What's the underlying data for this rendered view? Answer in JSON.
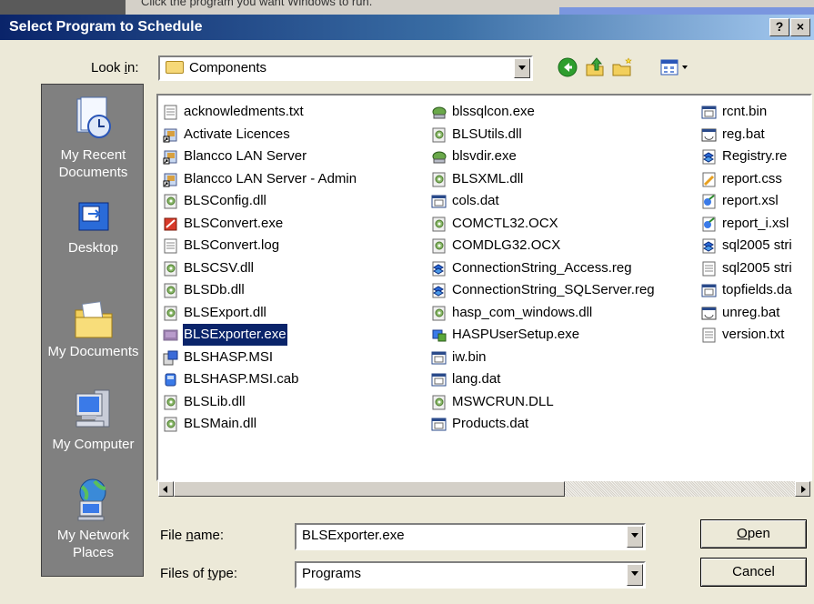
{
  "background_window": {
    "hint_text": "Click the program you want Windows to run."
  },
  "titlebar": {
    "title": "Select Program to Schedule",
    "help_label": "?",
    "close_label": "×"
  },
  "lookin": {
    "label": "Look in:",
    "accel": "i",
    "value": "Components"
  },
  "toolbar": {
    "icons": [
      "back-icon",
      "up-folder-icon",
      "new-folder-icon",
      "view-menu-icon"
    ]
  },
  "places": [
    {
      "label": "My Recent Documents",
      "icon": "recent-documents-icon"
    },
    {
      "label": "Desktop",
      "icon": "desktop-icon"
    },
    {
      "label": "My Documents",
      "icon": "my-documents-icon"
    },
    {
      "label": "My Computer",
      "icon": "my-computer-icon"
    },
    {
      "label": "My Network Places",
      "icon": "network-places-icon"
    }
  ],
  "files": {
    "col1": [
      {
        "name": "acknowledments.txt",
        "type": "txt"
      },
      {
        "name": "Activate Licences",
        "type": "shortcut"
      },
      {
        "name": "Blancco LAN Server",
        "type": "shortcut"
      },
      {
        "name": "Blancco LAN Server - Admin",
        "type": "shortcut"
      },
      {
        "name": "BLSConfig.dll",
        "type": "dll"
      },
      {
        "name": "BLSConvert.exe",
        "type": "exe-red"
      },
      {
        "name": "BLSConvert.log",
        "type": "txt"
      },
      {
        "name": "BLSCSV.dll",
        "type": "dll"
      },
      {
        "name": "BLSDb.dll",
        "type": "dll"
      },
      {
        "name": "BLSExport.dll",
        "type": "dll"
      },
      {
        "name": "BLSExporter.exe",
        "type": "exe",
        "selected": true
      },
      {
        "name": "BLSHASP.MSI",
        "type": "msi"
      },
      {
        "name": "BLSHASP.MSI.cab",
        "type": "cab"
      },
      {
        "name": "BLSLib.dll",
        "type": "dll"
      },
      {
        "name": "BLSMain.dll",
        "type": "dll"
      }
    ],
    "col2": [
      {
        "name": "blssqlcon.exe",
        "type": "exe-net"
      },
      {
        "name": "BLSUtils.dll",
        "type": "dll"
      },
      {
        "name": "blsvdir.exe",
        "type": "exe-net"
      },
      {
        "name": "BLSXML.dll",
        "type": "dll"
      },
      {
        "name": "cols.dat",
        "type": "dat"
      },
      {
        "name": "COMCTL32.OCX",
        "type": "dll"
      },
      {
        "name": "COMDLG32.OCX",
        "type": "dll"
      },
      {
        "name": "ConnectionString_Access.reg",
        "type": "reg"
      },
      {
        "name": "ConnectionString_SQLServer.reg",
        "type": "reg"
      },
      {
        "name": "hasp_com_windows.dll",
        "type": "dll"
      },
      {
        "name": "HASPUserSetup.exe",
        "type": "exe-setup"
      },
      {
        "name": "iw.bin",
        "type": "dat"
      },
      {
        "name": "lang.dat",
        "type": "dat"
      },
      {
        "name": "MSWCRUN.DLL",
        "type": "dll"
      },
      {
        "name": "Products.dat",
        "type": "dat"
      }
    ],
    "col3": [
      {
        "name": "rcnt.bin",
        "type": "dat"
      },
      {
        "name": "reg.bat",
        "type": "bat"
      },
      {
        "name": "Registry.re",
        "type": "reg"
      },
      {
        "name": "report.css",
        "type": "css"
      },
      {
        "name": "report.xsl",
        "type": "xsl"
      },
      {
        "name": "report_i.xsl",
        "type": "xsl"
      },
      {
        "name": "sql2005 stri",
        "type": "reg"
      },
      {
        "name": "sql2005 stri",
        "type": "txt"
      },
      {
        "name": "topfields.da",
        "type": "dat"
      },
      {
        "name": "unreg.bat",
        "type": "bat"
      },
      {
        "name": "version.txt",
        "type": "txt"
      }
    ]
  },
  "filename": {
    "label_pre": "File ",
    "accel": "n",
    "label_post": "ame:",
    "value": "BLSExporter.exe"
  },
  "filetype": {
    "label_pre": "Files of ",
    "accel": "t",
    "label_post": "ype:",
    "value": "Programs"
  },
  "buttons": {
    "open_accel": "O",
    "open_rest": "pen",
    "cancel": "Cancel"
  },
  "colors": {
    "accent": "#0a246a",
    "places_bg": "#808080",
    "dialog_bg": "#ece9d8"
  }
}
